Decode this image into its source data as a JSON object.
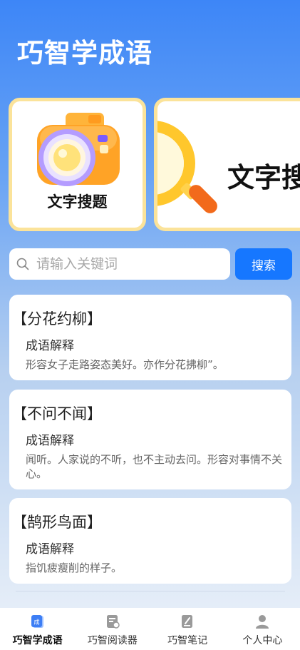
{
  "app_title": "巧智学成语",
  "banner": {
    "card1_label": "文字搜题",
    "card2_label": "文字搜"
  },
  "search": {
    "placeholder": "请输入关键词",
    "button_label": "搜索"
  },
  "idioms": [
    {
      "name": "【分花约柳】",
      "subtitle": "成语解释",
      "description": "形容女子走路姿态美好。亦作分花拂柳”。"
    },
    {
      "name": "【不问不闻】",
      "subtitle": "成语解释",
      "description": "闻听。人家说的不听，也不主动去问。形容对事情不关心。"
    },
    {
      "name": "【鹄形鸟面】",
      "subtitle": "成语解释",
      "description": "指饥疲瘦削的样子。"
    }
  ],
  "tabs": [
    {
      "label": "巧智学成语",
      "icon": "idiom-book-icon",
      "active": true
    },
    {
      "label": "巧智阅读器",
      "icon": "reader-icon",
      "active": false
    },
    {
      "label": "巧智笔记",
      "icon": "notebook-icon",
      "active": false
    },
    {
      "label": "个人中心",
      "icon": "person-icon",
      "active": false
    }
  ],
  "colors": {
    "accent": "#1677ff",
    "card_border": "#fbe39a",
    "header_gradient_top": "#3d86f7"
  }
}
